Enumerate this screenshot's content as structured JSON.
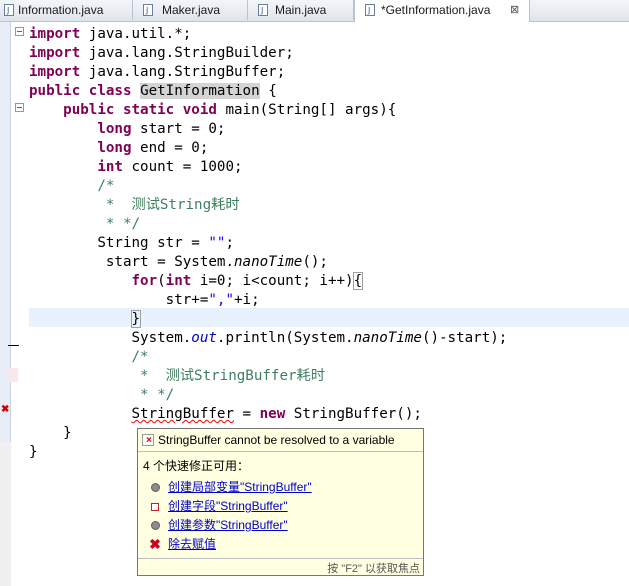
{
  "tabs": [
    {
      "label": "Information.java",
      "active": false
    },
    {
      "label": "Maker.java",
      "active": false
    },
    {
      "label": "Main.java",
      "active": false
    },
    {
      "label": "*GetInformation.java",
      "active": true,
      "close": "⊠"
    }
  ],
  "code": {
    "l1": {
      "kw": "import",
      "rest": " java.util.*;"
    },
    "l2": {
      "kw": "import",
      "rest": " java.lang.StringBuilder;"
    },
    "l3": {
      "kw": "import",
      "rest": " java.lang.StringBuffer;"
    },
    "l4": {
      "kw1": "public",
      "kw2": "class",
      "name": "GetInformation",
      "rest": " {"
    },
    "l5": {
      "kw1": "public",
      "kw2": "static",
      "kw3": "void",
      "rest": " main(String[] args){"
    },
    "l6": {
      "kw": "long",
      "rest": " start = 0;"
    },
    "l7": {
      "kw": "long",
      "rest": " end = 0;"
    },
    "l8": {
      "kw": "int",
      "rest": " count = 1000;"
    },
    "l9": "/*",
    "l10": " *  测试String耗时",
    "l11": " * */",
    "l12": {
      "pre": "String str = ",
      "str": "\"\"",
      "post": ";"
    },
    "l13": {
      "pre": "start = System.",
      "it": "nanoTime",
      "post": "();"
    },
    "l14": {
      "kw1": "for",
      "a": "(",
      "kw2": "int",
      "rest": " i=0; i<count; i++)",
      "brace": "{"
    },
    "l15": {
      "pre": "str+=",
      "str": "\",\"",
      "post": "+i;"
    },
    "l16": {
      "brace": "}"
    },
    "l17": {
      "a": "System.",
      "fld": "out",
      "b": ".println(System.",
      "it": "nanoTime",
      "c": "()-start);"
    },
    "l18": "/*",
    "l19": " *  测试StringBuffer耗时",
    "l20": " * */",
    "l21": {
      "err": "StringBuffer",
      "a": " = ",
      "kw": "new",
      "b": " StringBuffer();"
    },
    "l22": "}",
    "l23": "}"
  },
  "quickfix": {
    "title": "StringBuffer cannot be resolved to a variable",
    "count_label": "4 个快速修正可用：",
    "fixes": [
      {
        "label": "创建局部变量\"StringBuffer\"",
        "icon": "local-variable-icon"
      },
      {
        "label": "创建字段\"StringBuffer\"",
        "icon": "field-icon"
      },
      {
        "label": "创建参数\"StringBuffer\"",
        "icon": "parameter-icon"
      },
      {
        "label": "除去赋值",
        "icon": "remove-icon"
      }
    ],
    "footer": "按 \"F2\" 以获取焦点"
  },
  "colors": {
    "keyword": "#7f0055",
    "comment": "#3f7f5f",
    "string": "#2a00ff",
    "field": "#0000c0",
    "link": "#0000cc",
    "popup_bg": "#ffffe1"
  }
}
